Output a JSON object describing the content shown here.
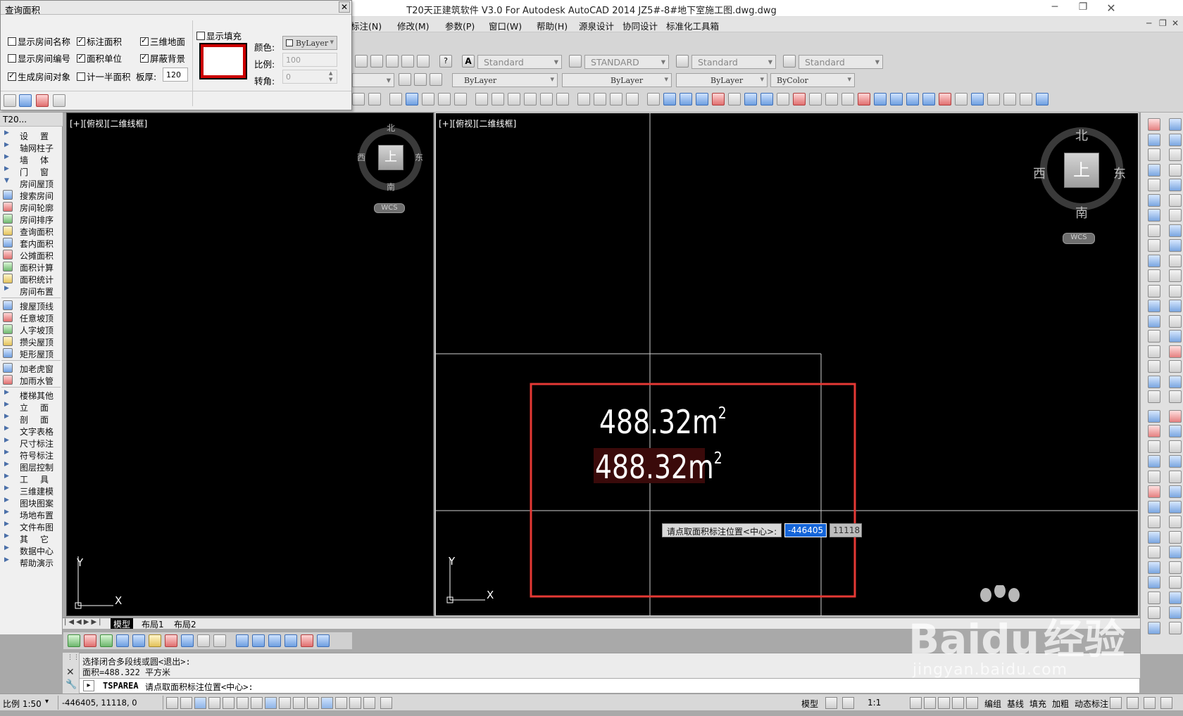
{
  "window": {
    "title": "T20天正建筑软件 V3.0 For Autodesk AutoCAD 2014    JZ5#-8#地下室施工图.dwg.dwg"
  },
  "menu": [
    "标注(N)",
    "修改(M)",
    "参数(P)",
    "窗口(W)",
    "帮助(H)",
    "源泉设计",
    "协同设计",
    "标准化工具箱"
  ],
  "toolbar": {
    "text_style": "Standard",
    "dim_style": "STANDARD",
    "table_style": "Standard",
    "mleader_style": "Standard",
    "layer": "ByLayer",
    "linetype": "ByLayer",
    "lineweight": "ByLayer",
    "plotstyle": "ByColor"
  },
  "query_panel": {
    "title": "查询面积",
    "options": [
      {
        "label": "显示房间名称",
        "checked": false
      },
      {
        "label": "标注面积",
        "checked": true
      },
      {
        "label": "三维地面",
        "checked": true
      },
      {
        "label": "显示房间编号",
        "checked": false
      },
      {
        "label": "面积单位",
        "checked": true
      },
      {
        "label": "屏蔽背景",
        "checked": true
      },
      {
        "label": "生成房间对象",
        "checked": true
      },
      {
        "label": "计一半面积",
        "checked": false
      }
    ],
    "slab_label": "板厚:",
    "slab_value": "120",
    "show_fill_label": "显示填充",
    "show_fill_checked": false,
    "color_label": "颜色:",
    "color_value": "ByLayer",
    "scale_label": "比例:",
    "scale_value": "100",
    "angle_label": "转角:",
    "angle_value": "0"
  },
  "left_panel": {
    "header": "T20...",
    "groups": [
      {
        "label": "设置",
        "spaced": true
      },
      {
        "label": "轴网柱子"
      },
      {
        "label": "墙体",
        "spaced": true
      },
      {
        "label": "门窗",
        "spaced": true
      },
      {
        "label": "房间屋顶",
        "expanded": true
      }
    ],
    "room_items": [
      "搜索房间",
      "房间轮廓",
      "房间排序",
      "查询面积",
      "套内面积",
      "公摊面积",
      "面积计算",
      "面积统计"
    ],
    "room_layout": "房间布置",
    "roof_items": [
      "搜屋顶线",
      "任意坡顶",
      "人字坡顶",
      "攒尖屋顶",
      "矩形屋顶"
    ],
    "misc_items": [
      "加老虎窗",
      "加雨水管"
    ],
    "bottom_groups": [
      {
        "label": "楼梯其他"
      },
      {
        "label": "立面",
        "spaced": true
      },
      {
        "label": "剖面",
        "spaced": true
      },
      {
        "label": "文字表格"
      },
      {
        "label": "尺寸标注"
      },
      {
        "label": "符号标注"
      },
      {
        "label": "图层控制"
      },
      {
        "label": "工具",
        "spaced": true
      },
      {
        "label": "三维建模"
      },
      {
        "label": "图块图案"
      },
      {
        "label": "场地布置"
      },
      {
        "label": "文件布图"
      },
      {
        "label": "其它",
        "spaced": true
      },
      {
        "label": "数据中心"
      },
      {
        "label": "帮助演示"
      }
    ]
  },
  "viewports": {
    "left_label": "[+][俯视][二维线框]",
    "right_label": "[+][俯视][二维线框]",
    "compass": {
      "north": "北",
      "south": "南",
      "east": "东",
      "west": "西",
      "top": "上",
      "wcs": "WCS"
    },
    "axis_x": "X",
    "axis_y": "Y"
  },
  "drawing": {
    "area_text_1": "488.32m",
    "area_text_2": "488.32m",
    "superscript": "2",
    "prompt": "请点取面积标注位置<中心>:",
    "coord_x": "-446405",
    "coord_y": "11118"
  },
  "tabs": [
    "模型",
    "布局1",
    "布局2"
  ],
  "command": {
    "history_1": "选择闭合多段线或圆<退出>:",
    "history_2": "面积=488.322 平方米",
    "prompt_cmd": "TSPAREA",
    "prompt_text": "请点取面积标注位置<中心>:"
  },
  "status": {
    "scale": "比例 1:50",
    "coords": "-446405, 11118, 0",
    "model": "模型",
    "annot_scale": "1:1",
    "toggles": [
      "编组",
      "基线",
      "填充",
      "加粗",
      "动态标注"
    ]
  },
  "watermark": {
    "brand": "Baidu",
    "brand_cn": "经验",
    "url": "jingyan.baidu.com"
  }
}
